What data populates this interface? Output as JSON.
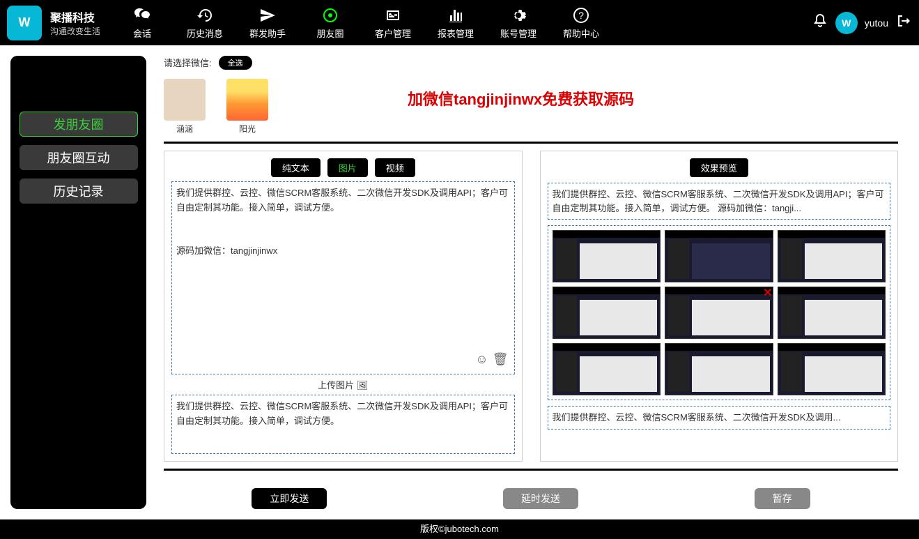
{
  "brand": {
    "title": "聚播科技",
    "sub": "沟通改变生活"
  },
  "nav": [
    {
      "label": "会话"
    },
    {
      "label": "历史消息"
    },
    {
      "label": "群发助手"
    },
    {
      "label": "朋友圈"
    },
    {
      "label": "客户管理"
    },
    {
      "label": "报表管理"
    },
    {
      "label": "账号管理"
    },
    {
      "label": "帮助中心"
    }
  ],
  "user": {
    "name": "yutou"
  },
  "sidebar": [
    {
      "label": "发朋友圈",
      "active": true
    },
    {
      "label": "朋友圈互动",
      "active": false
    },
    {
      "label": "历史记录",
      "active": false
    }
  ],
  "select": {
    "label": "请选择微信:",
    "all": "全选"
  },
  "avatars": [
    {
      "name": "涵涵"
    },
    {
      "name": "阳光"
    }
  ],
  "banner": "加微信tangjinjinwx免费获取源码",
  "tabs": [
    {
      "label": "纯文本"
    },
    {
      "label": "图片"
    },
    {
      "label": "视频"
    }
  ],
  "content_text": "我们提供群控、云控、微信SCRM客服系统、二次微信开发SDK及调用API；客户可自由定制其功能。接入简单，调试方便。\n\n\n源码加微信：tangjinjinwx",
  "upload_label": "上传图片",
  "comment_text": "我们提供群控、云控、微信SCRM客服系统、二次微信开发SDK及调用API；客户可自由定制其功能。接入简单，调试方便。",
  "preview": {
    "title": "效果预览",
    "top_text": "我们提供群控、云控、微信SCRM客服系统、二次微信开发SDK及调用API；客户可自由定制其功能。接入简单，调试方便。 源码加微信：tangji...",
    "bottom_text": "我们提供群控、云控、微信SCRM客服系统、二次微信开发SDK及调用..."
  },
  "actions": {
    "send_now": "立即发送",
    "send_delay": "延时发送",
    "save_draft": "暂存"
  },
  "footer": "版权©jubotech.com"
}
